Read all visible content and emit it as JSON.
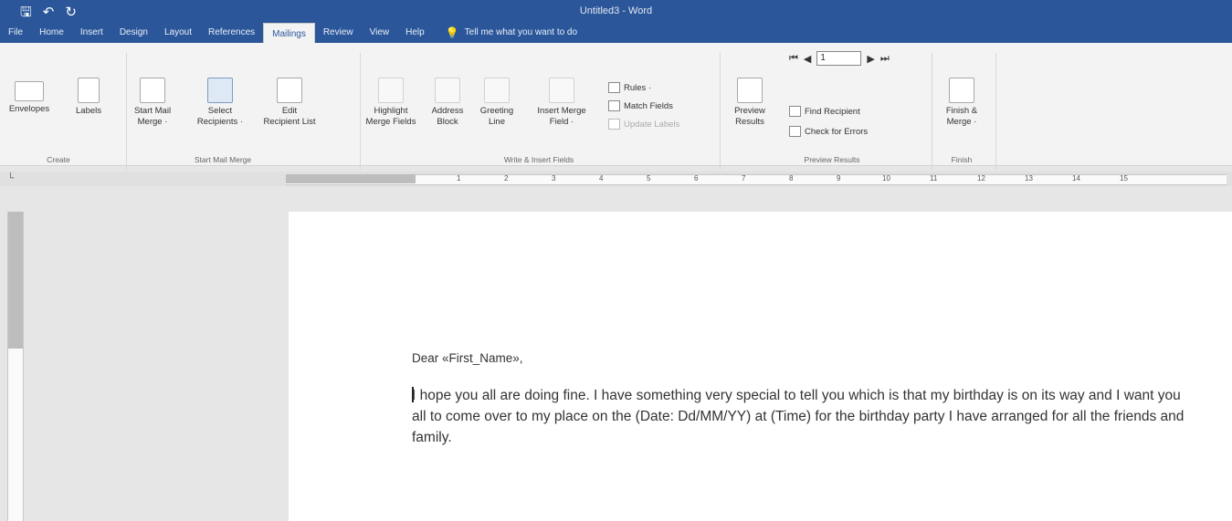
{
  "window": {
    "title": "Untitled3 - Word",
    "qat": [
      "save-icon",
      "undo-icon",
      "repeat-icon"
    ]
  },
  "tabs": [
    "File",
    "Home",
    "Insert",
    "Design",
    "Layout",
    "References",
    "Mailings",
    "Review",
    "View",
    "Help"
  ],
  "tell_me": {
    "label": "Tell me what you want to do"
  },
  "ribbon": {
    "create": {
      "label": "Create",
      "envelopes": "Envelopes",
      "labels": "Labels"
    },
    "start_mail_merge": {
      "label": "Start Mail Merge",
      "start_l1": "Start Mail",
      "start_l2": "Merge ·",
      "select_l1": "Select",
      "select_l2": "Recipients ·",
      "edit_l1": "Edit",
      "edit_l2": "Recipient List"
    },
    "write_insert": {
      "label": "Write & Insert Fields",
      "highlight_l1": "Highlight",
      "highlight_l2": "Merge Fields",
      "address_l1": "Address",
      "address_l2": "Block",
      "greeting_l1": "Greeting",
      "greeting_l2": "Line",
      "insert_l1": "Insert Merge",
      "insert_l2": "Field ·",
      "rules": "Rules ·",
      "match": "Match Fields",
      "update": "Update Labels"
    },
    "preview": {
      "label": "Preview Results",
      "preview_l1": "Preview",
      "preview_l2": "Results",
      "record": "1",
      "find": "Find Recipient",
      "check": "Check for Errors"
    },
    "finish": {
      "label": "Finish",
      "finish_l1": "Finish &",
      "finish_l2": "Merge ·"
    }
  },
  "ruler": {
    "numbers": [
      "1",
      "2",
      "3",
      "4",
      "5",
      "6",
      "7",
      "8",
      "9",
      "10",
      "11",
      "12",
      "13",
      "14",
      "15"
    ]
  },
  "document": {
    "salutation": "Dear «First_Name»,",
    "body": "I hope you all are doing fine. I have something very special to tell you which is that my birthday is on its way and I want you all to come over to my place on the (Date: Dd/MM/YY) at (Time) for the birthday party I have arranged for all the friends and family."
  },
  "colors": {
    "accent": "#2b579a",
    "ribbon": "#f3f3f3",
    "workspace": "#e6e6e6"
  }
}
